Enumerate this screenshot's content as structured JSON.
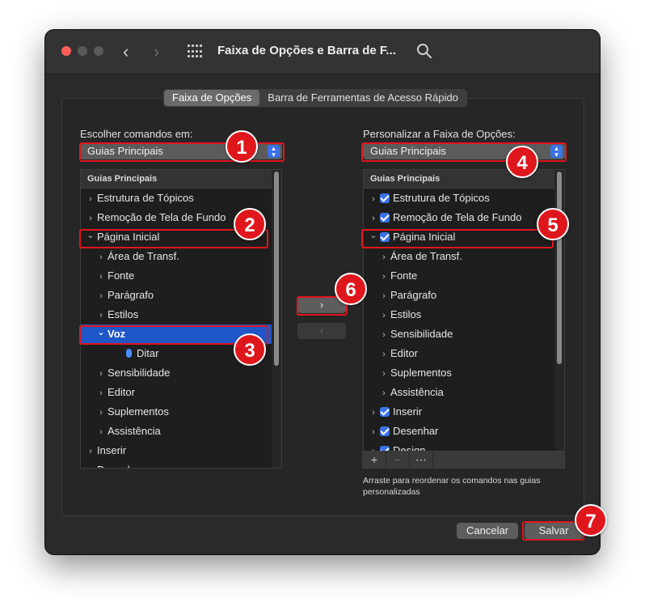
{
  "window": {
    "title": "Faixa de Opções e Barra de F...",
    "nav_back": "‹",
    "nav_forward": "›"
  },
  "tabs": [
    {
      "label": "Faixa de Opções",
      "active": true
    },
    {
      "label": "Barra de Ferramentas de Acesso Rápido",
      "active": false
    }
  ],
  "left": {
    "label": "Escolher comandos em:",
    "popup_value": "Guias Principais",
    "list_header": "Guias Principais",
    "items": [
      {
        "label": "Estrutura de Tópicos",
        "arrow": ">",
        "indent": 0
      },
      {
        "label": "Remoção de Tela de Fundo",
        "arrow": ">",
        "indent": 0
      },
      {
        "label": "Página Inicial",
        "arrow": "v",
        "indent": 0
      },
      {
        "label": "Área de Transf.",
        "arrow": ">",
        "indent": 1
      },
      {
        "label": "Fonte",
        "arrow": ">",
        "indent": 1
      },
      {
        "label": "Parágrafo",
        "arrow": ">",
        "indent": 1
      },
      {
        "label": "Estilos",
        "arrow": ">",
        "indent": 1
      },
      {
        "label": "Voz",
        "arrow": "v",
        "indent": 1,
        "selected": true
      },
      {
        "label": "Ditar",
        "arrow": "",
        "indent": 2,
        "icon": "microphone-icon"
      },
      {
        "label": "Sensibilidade",
        "arrow": ">",
        "indent": 1
      },
      {
        "label": "Editor",
        "arrow": ">",
        "indent": 1
      },
      {
        "label": "Suplementos",
        "arrow": ">",
        "indent": 1
      },
      {
        "label": "Assistência",
        "arrow": ">",
        "indent": 1
      },
      {
        "label": "Inserir",
        "arrow": ">",
        "indent": 0
      },
      {
        "label": "Desenhar",
        "arrow": ">",
        "indent": 0
      }
    ]
  },
  "right": {
    "label": "Personalizar a Faixa de Opções:",
    "popup_value": "Guias Principais",
    "list_header": "Guias Principais",
    "items": [
      {
        "label": "Estrutura de Tópicos",
        "arrow": ">",
        "indent": 0,
        "checked": true
      },
      {
        "label": "Remoção de Tela de Fundo",
        "arrow": ">",
        "indent": 0,
        "checked": true
      },
      {
        "label": "Página Inicial",
        "arrow": "v",
        "indent": 0,
        "checked": true
      },
      {
        "label": "Área de Transf.",
        "arrow": ">",
        "indent": 1
      },
      {
        "label": "Fonte",
        "arrow": ">",
        "indent": 1
      },
      {
        "label": "Parágrafo",
        "arrow": ">",
        "indent": 1
      },
      {
        "label": "Estilos",
        "arrow": ">",
        "indent": 1
      },
      {
        "label": "Sensibilidade",
        "arrow": ">",
        "indent": 1
      },
      {
        "label": "Editor",
        "arrow": ">",
        "indent": 1
      },
      {
        "label": "Suplementos",
        "arrow": ">",
        "indent": 1
      },
      {
        "label": "Assistência",
        "arrow": ">",
        "indent": 1
      },
      {
        "label": "Inserir",
        "arrow": ">",
        "indent": 0,
        "checked": true
      },
      {
        "label": "Desenhar",
        "arrow": ">",
        "indent": 0,
        "checked": true
      },
      {
        "label": "Design",
        "arrow": ">",
        "indent": 0,
        "checked": true
      }
    ],
    "toolbar": {
      "add": "+",
      "remove": "−",
      "more": "⋯"
    },
    "note": "Arraste para reordenar os comandos nas guias personalizadas"
  },
  "move": {
    "add": "›",
    "remove": "‹"
  },
  "footer": {
    "cancel": "Cancelar",
    "save": "Salvar"
  },
  "badges": [
    "1",
    "2",
    "3",
    "4",
    "5",
    "6",
    "7"
  ],
  "colors": {
    "highlight": "#e0161d",
    "accent": "#3a72e8",
    "selection": "#1f57c9"
  }
}
